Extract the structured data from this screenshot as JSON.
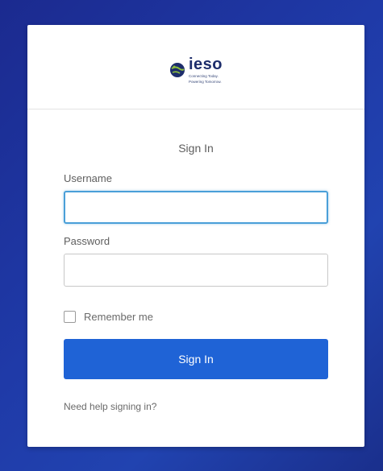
{
  "logo": {
    "word": "ieso",
    "tagline_line1": "Connecting Today.",
    "tagline_line2": "Powering Tomorrow.",
    "icon": "globe-icon"
  },
  "form": {
    "title": "Sign In",
    "username_label": "Username",
    "username_value": "",
    "password_label": "Password",
    "password_value": "",
    "remember_label": "Remember me",
    "remember_checked": false,
    "submit_label": "Sign In",
    "help_link": "Need help signing in?"
  },
  "colors": {
    "background": "#1f3aa8",
    "primary_button": "#1f63d6",
    "focus_border": "#4a9fd8"
  }
}
